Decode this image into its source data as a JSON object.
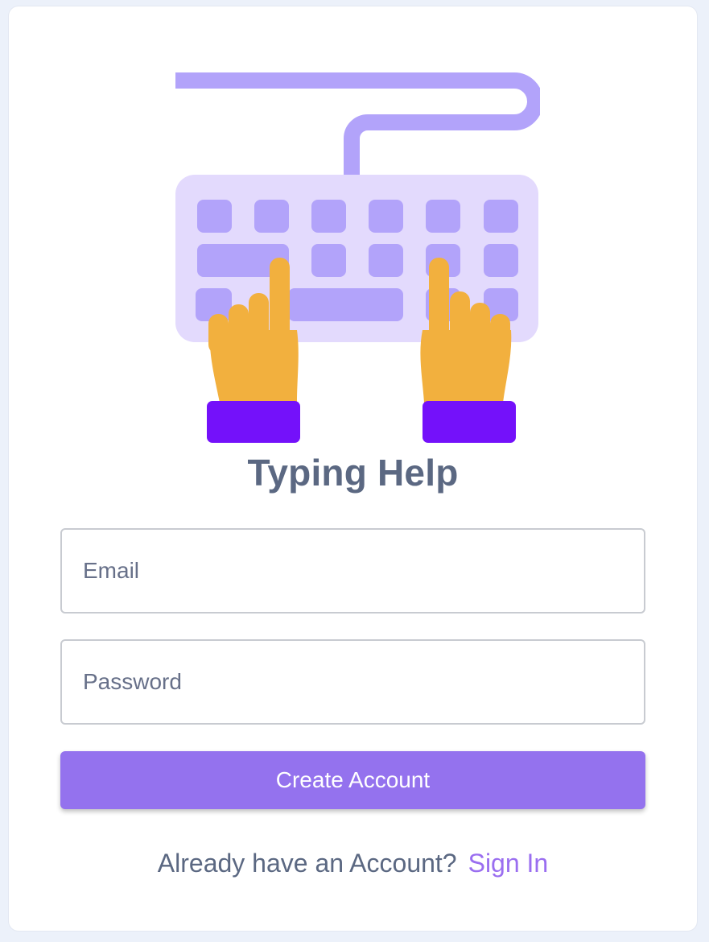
{
  "app": {
    "title": "Typing Help"
  },
  "illustration": {
    "icon": "keyboard-typing-hands-icon",
    "colors": {
      "cable": "#B2A3FA",
      "keyboard_body": "#E3DAFD",
      "keys": "#B2A3FA",
      "hands": "#F2B03E",
      "cuffs": "#7411FA"
    }
  },
  "form": {
    "email": {
      "value": "",
      "placeholder": "Email"
    },
    "password": {
      "value": "",
      "placeholder": "Password"
    },
    "submit_label": "Create Account"
  },
  "footer": {
    "prompt": "Already have an Account?",
    "signin_label": "Sign In"
  },
  "colors": {
    "background": "#ECF1FA",
    "card": "#FFFFFF",
    "text": "#5B6882",
    "accent": "#9472EE",
    "link": "#9A6EF0",
    "input_border": "#C8CBD1"
  }
}
